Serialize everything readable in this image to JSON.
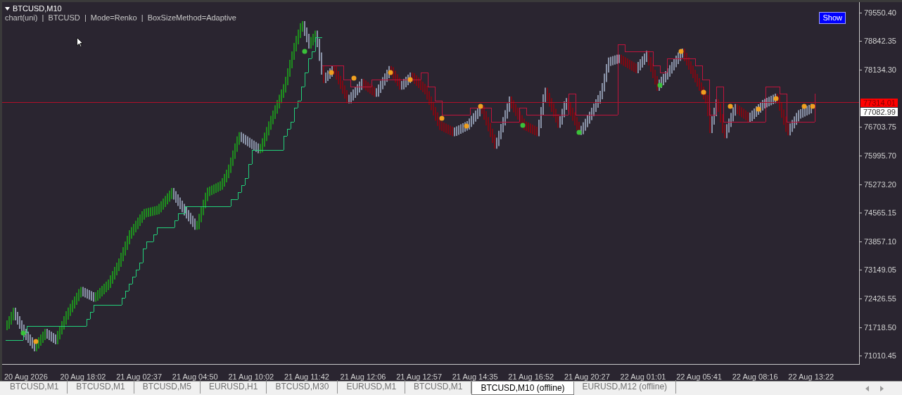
{
  "chart": {
    "title": "BTCUSD,M10",
    "info": "chart(uni)  |  BTCUSD  |  Mode=Renko  |  BoxSizeMethod=Adaptive",
    "show_button": "Show"
  },
  "price_axis": [
    "79550.40",
    "78842.35",
    "78134.30",
    "76703.75",
    "75995.70",
    "75273.20",
    "74565.15",
    "73857.10",
    "73149.05",
    "72426.55",
    "71718.50",
    "71010.45"
  ],
  "price_labels": [
    {
      "kind": "bid",
      "text": "77314.01"
    },
    {
      "kind": "last",
      "text": "77082.99"
    }
  ],
  "time_axis": [
    "20 Aug 2026",
    "20 Aug 18:02",
    "21 Aug 02:37",
    "21 Aug 04:50",
    "21 Aug 10:02",
    "21 Aug 11:42",
    "21 Aug 12:06",
    "21 Aug 12:57",
    "21 Aug 14:35",
    "21 Aug 16:52",
    "21 Aug 20:27",
    "22 Aug 01:01",
    "22 Aug 05:41",
    "22 Aug 08:16",
    "22 Aug 13:22"
  ],
  "tabs": [
    {
      "label": "BTCUSD,M1",
      "selected": false
    },
    {
      "label": "BTCUSD,M1",
      "selected": false
    },
    {
      "label": "BTCUSD,M5",
      "selected": false
    },
    {
      "label": "EURUSD,H1",
      "selected": false
    },
    {
      "label": "BTCUSD,M30",
      "selected": false
    },
    {
      "label": "EURUSD,M1",
      "selected": false
    },
    {
      "label": "BTCUSD,M1",
      "selected": false
    },
    {
      "label": "BTCUSD,M10 (offline)",
      "selected": true
    },
    {
      "label": "EURUSD,M12 (offline)",
      "selected": false
    }
  ]
}
